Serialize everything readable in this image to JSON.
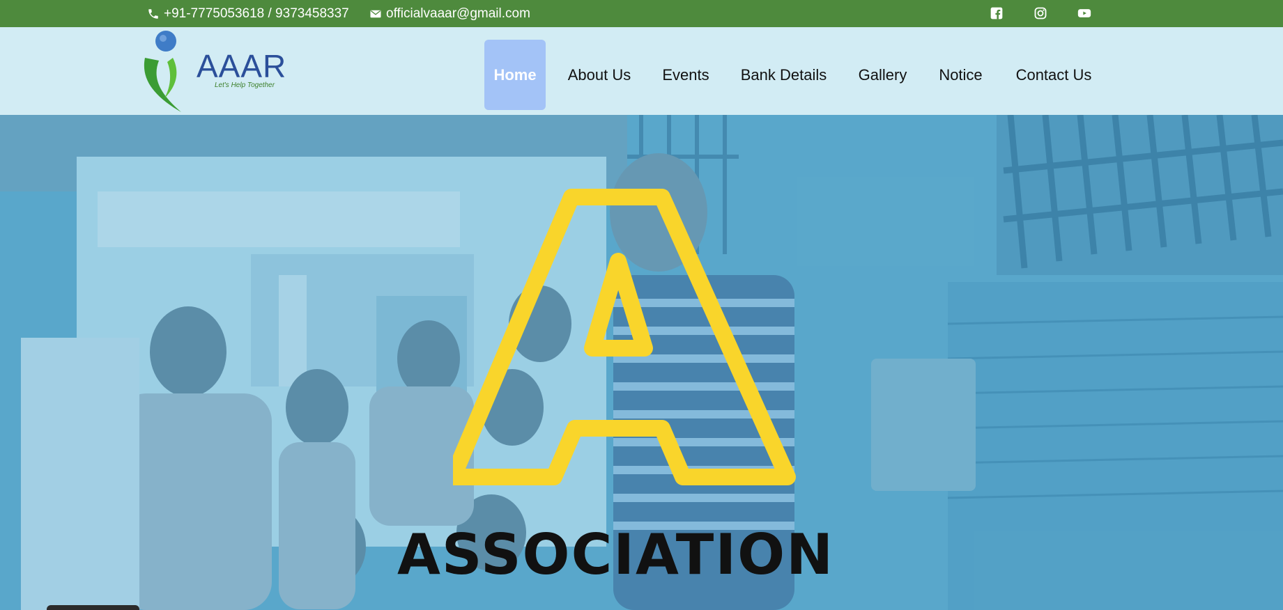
{
  "topbar": {
    "phone": "+91-7775053618 / 9373458337",
    "email": "officialvaaar@gmail.com",
    "social": [
      "facebook-icon",
      "instagram-icon",
      "youtube-icon"
    ]
  },
  "logo": {
    "word": "AAAR",
    "tagline": "Let's Help Together"
  },
  "nav": {
    "items": [
      {
        "label": "Home",
        "active": true
      },
      {
        "label": "About Us"
      },
      {
        "label": "Events"
      },
      {
        "label": "Bank Details"
      },
      {
        "label": "Gallery"
      },
      {
        "label": "Notice"
      },
      {
        "label": "Contact Us"
      }
    ]
  },
  "hero": {
    "title": "ASSOCIATION"
  },
  "colors": {
    "topbar": "#4e8a3d",
    "header": "#d2ecf4",
    "nav_active": "#a3c3f7",
    "accent_yellow": "#f9d52b",
    "logo_blue": "#2b4f9a",
    "logo_green": "#3c7f2a"
  }
}
